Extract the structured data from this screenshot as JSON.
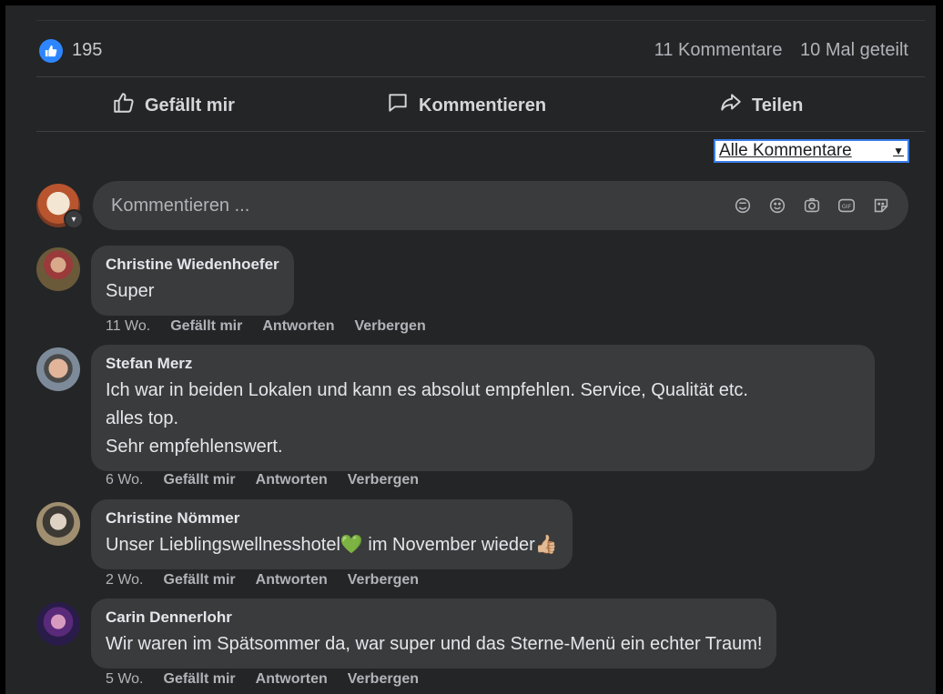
{
  "stats": {
    "like_count": "195",
    "comments": "11 Kommentare",
    "shares": "10 Mal geteilt"
  },
  "actions": {
    "like": "Gefällt mir",
    "comment": "Kommentieren",
    "share": "Teilen"
  },
  "sort": {
    "label": "Alle Kommentare"
  },
  "composer": {
    "placeholder": "Kommentieren ...",
    "icons": [
      "avatar-sticker-icon",
      "emoji-icon",
      "camera-icon",
      "gif-icon",
      "sticker-icon"
    ]
  },
  "comments": [
    {
      "author": "Christine Wiedenhoefer",
      "text": "Super",
      "time": "11 Wo.",
      "like": "Gefällt mir",
      "reply": "Antworten",
      "hide": "Verbergen"
    },
    {
      "author": "Stefan Merz",
      "text": "Ich war in beiden Lokalen und kann es absolut empfehlen. Service, Qualität etc.\nalles top.\nSehr empfehlenswert.",
      "time": "6 Wo.",
      "like": "Gefällt mir",
      "reply": "Antworten",
      "hide": "Verbergen"
    },
    {
      "author": "Christine Nömmer",
      "text": "Unser Lieblingswellnesshotel💚 im November wieder👍🏼",
      "time": "2 Wo.",
      "like": "Gefällt mir",
      "reply": "Antworten",
      "hide": "Verbergen"
    },
    {
      "author": "Carin Dennerlohr",
      "text": "Wir waren im Spätsommer da, war super und das Sterne-Menü ein echter Traum!",
      "time": "5 Wo.",
      "like": "Gefällt mir",
      "reply": "Antworten",
      "hide": "Verbergen"
    }
  ],
  "colors": {
    "background": "#242526",
    "bubble": "#3a3b3c",
    "like_blue": "#2d86ff",
    "focus_outline": "#3a7de8"
  }
}
